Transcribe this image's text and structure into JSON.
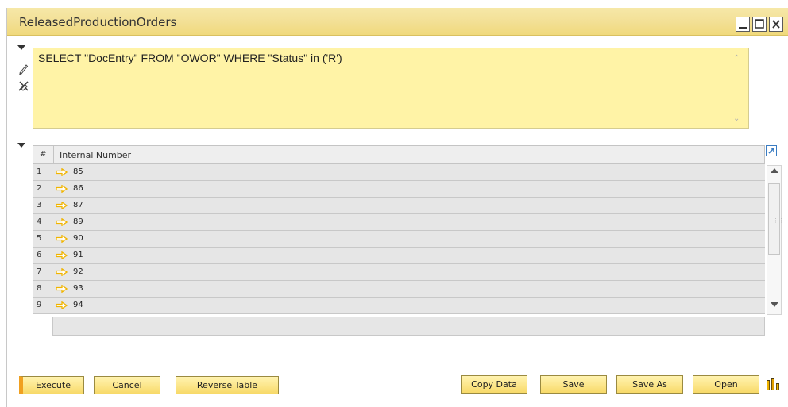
{
  "window": {
    "title": "ReleasedProductionOrders"
  },
  "query": {
    "text": "SELECT \"DocEntry\" FROM \"OWOR\" WHERE \"Status\" in ('R')"
  },
  "grid": {
    "columns": {
      "number": "#",
      "internal_number": "Internal Number"
    },
    "rows": [
      {
        "n": "1",
        "value": "85"
      },
      {
        "n": "2",
        "value": "86"
      },
      {
        "n": "3",
        "value": "87"
      },
      {
        "n": "4",
        "value": "89"
      },
      {
        "n": "5",
        "value": "90"
      },
      {
        "n": "6",
        "value": "91"
      },
      {
        "n": "7",
        "value": "92"
      },
      {
        "n": "8",
        "value": "93"
      },
      {
        "n": "9",
        "value": "94"
      }
    ]
  },
  "buttons": {
    "execute": "Execute",
    "cancel": "Cancel",
    "reverse_table": "Reverse Table",
    "copy_data": "Copy Data",
    "save": "Save",
    "save_as": "Save As",
    "open": "Open"
  },
  "icons": {
    "pencil": "pencil-icon",
    "eraser": "eraser-icon",
    "link_arrow": "link-arrow-icon",
    "expand": "expand-icon",
    "chart": "chart-icon"
  },
  "colors": {
    "title_bar": "#f3e096",
    "query_bg": "#fff3a6",
    "button_bg": "#fce68a",
    "execute_accent": "#f0a020",
    "link_arrow": "#f0b400",
    "grid_row": "#e6e6e6"
  }
}
